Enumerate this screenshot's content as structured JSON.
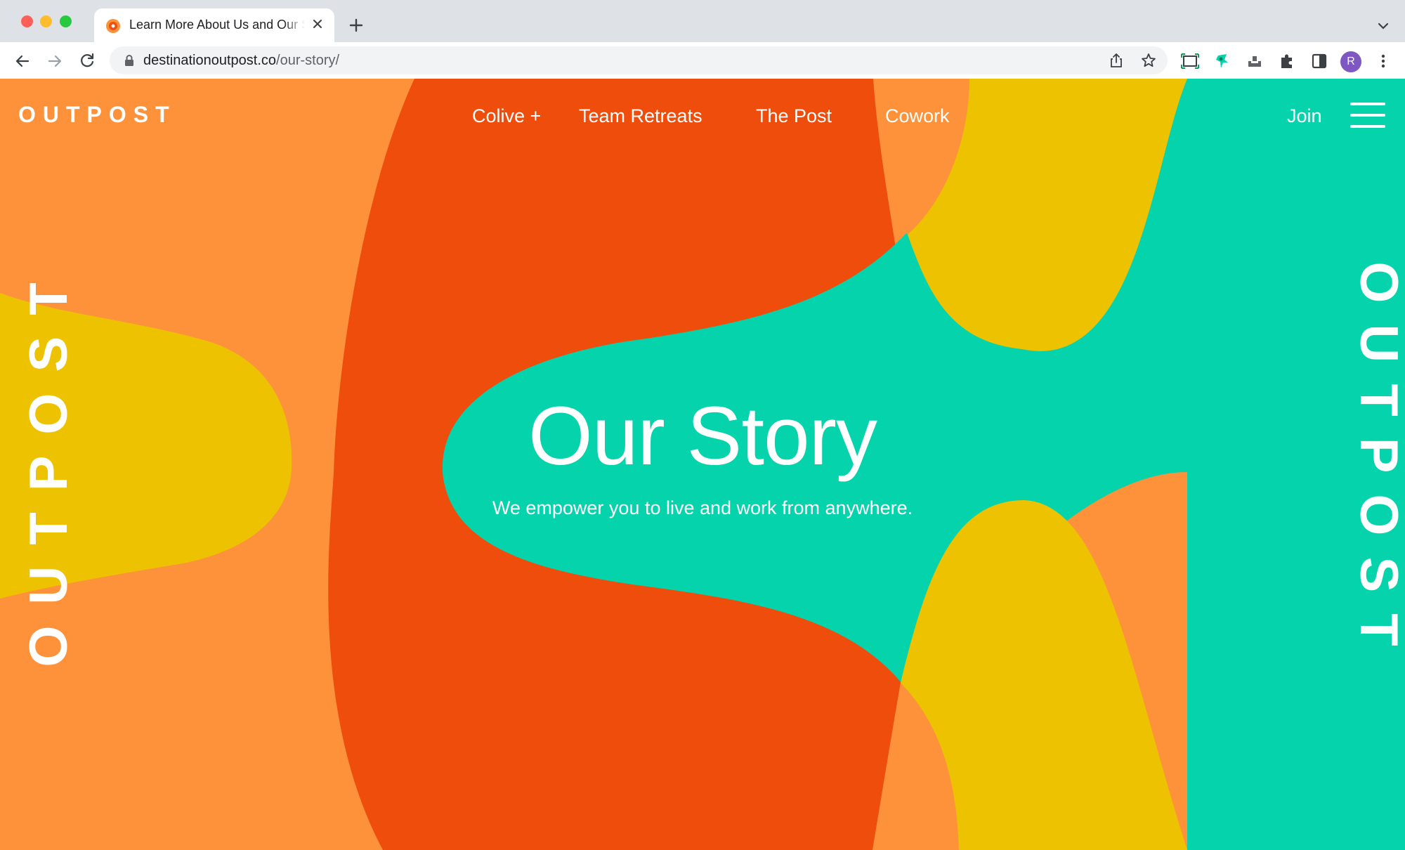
{
  "browser": {
    "tab_title": "Learn More About Us and Our Story",
    "url_domain": "destinationoutpost.co",
    "url_path": "/our-story/",
    "profile_initial": "R",
    "accent": "#7e57c2",
    "icons": [
      "back-icon",
      "forward-icon",
      "reload-icon",
      "lock-icon",
      "share-icon",
      "star-icon",
      "screenshot-icon",
      "extension-icon",
      "puzzle-icon",
      "side-panel-icon",
      "menu-icon"
    ]
  },
  "site": {
    "logo": "OUTPOST",
    "nav": {
      "colive": "Colive +",
      "team_retreats": "Team Retreats",
      "the_post": "The Post",
      "cowork": "Cowork",
      "join": "Join"
    },
    "side_text_left": "OUTPOST",
    "side_text_right": "OUTPOST"
  },
  "hero": {
    "title": "Our Story",
    "subtitle": "We empower you to live and work from anywhere."
  },
  "colors": {
    "light_orange": "#fe923b",
    "red_orange": "#ef4d0b",
    "teal": "#05d3ac",
    "yellow": "#edc301"
  }
}
